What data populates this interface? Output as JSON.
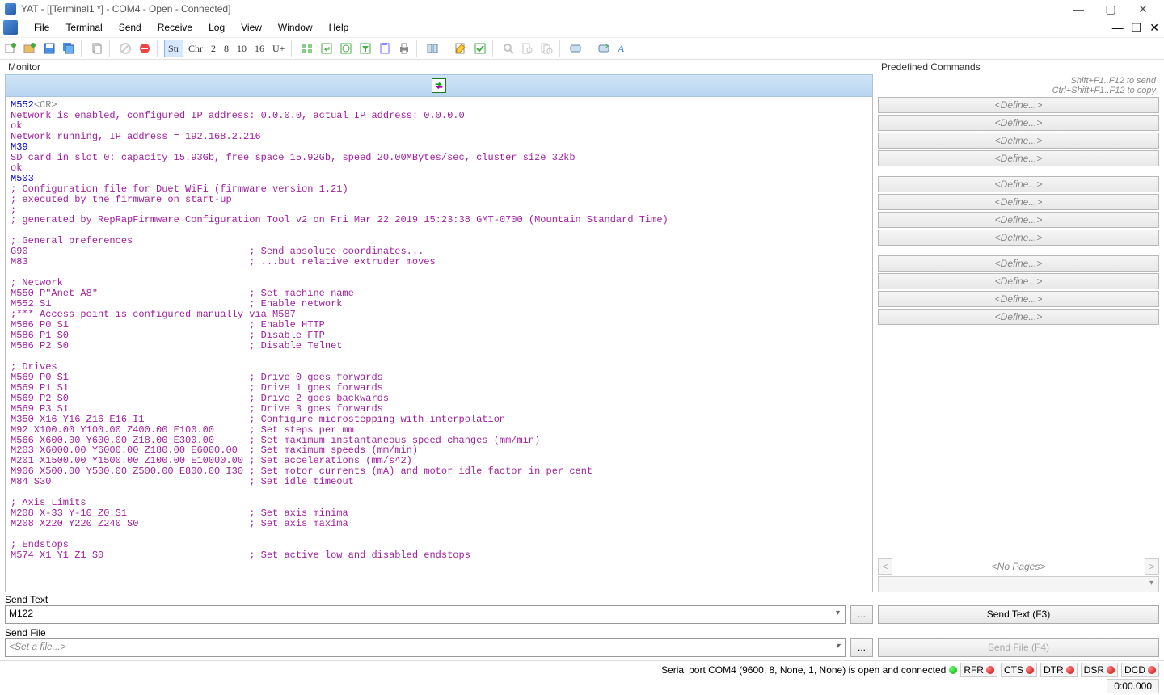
{
  "title": "YAT - [[Terminal1 *] - COM4 - Open - Connected]",
  "menu": {
    "file": "File",
    "terminal": "Terminal",
    "send": "Send",
    "receive": "Receive",
    "log": "Log",
    "view": "View",
    "window": "Window",
    "help": "Help"
  },
  "toolbar": {
    "str": "Str",
    "chr": "Chr",
    "n2": "2",
    "n8": "8",
    "n10": "10",
    "n16": "16",
    "uplus": "U+",
    "afont": "A"
  },
  "monitor": {
    "label": "Monitor",
    "lines": [
      {
        "cls": "cmd",
        "text": "M552",
        "suffix": "<CR>"
      },
      {
        "cls": "",
        "text": "Network is enabled, configured IP address: 0.0.0.0, actual IP address: 0.0.0.0"
      },
      {
        "cls": "",
        "text": "ok"
      },
      {
        "cls": "",
        "text": "Network running, IP address = 192.168.2.216"
      },
      {
        "cls": "cmd",
        "text": "M39"
      },
      {
        "cls": "",
        "text": "SD card in slot 0: capacity 15.93Gb, free space 15.92Gb, speed 20.00MBytes/sec, cluster size 32kb"
      },
      {
        "cls": "",
        "text": "ok"
      },
      {
        "cls": "cmd",
        "text": "M503"
      },
      {
        "cls": "",
        "text": "; Configuration file for Duet WiFi (firmware version 1.21)"
      },
      {
        "cls": "",
        "text": "; executed by the firmware on start-up"
      },
      {
        "cls": "",
        "text": ";"
      },
      {
        "cls": "",
        "text": "; generated by RepRapFirmware Configuration Tool v2 on Fri Mar 22 2019 15:23:38 GMT-0700 (Mountain Standard Time)"
      },
      {
        "cls": "",
        "text": ""
      },
      {
        "cls": "",
        "text": "; General preferences"
      },
      {
        "cls": "",
        "text": "G90                                      ; Send absolute coordinates..."
      },
      {
        "cls": "",
        "text": "M83                                      ; ...but relative extruder moves"
      },
      {
        "cls": "",
        "text": ""
      },
      {
        "cls": "",
        "text": "; Network"
      },
      {
        "cls": "",
        "text": "M550 P\"Anet A8\"                          ; Set machine name"
      },
      {
        "cls": "",
        "text": "M552 S1                                  ; Enable network"
      },
      {
        "cls": "",
        "text": ";*** Access point is configured manually via M587"
      },
      {
        "cls": "",
        "text": "M586 P0 S1                               ; Enable HTTP"
      },
      {
        "cls": "",
        "text": "M586 P1 S0                               ; Disable FTP"
      },
      {
        "cls": "",
        "text": "M586 P2 S0                               ; Disable Telnet"
      },
      {
        "cls": "",
        "text": ""
      },
      {
        "cls": "",
        "text": "; Drives"
      },
      {
        "cls": "",
        "text": "M569 P0 S1                               ; Drive 0 goes forwards"
      },
      {
        "cls": "",
        "text": "M569 P1 S1                               ; Drive 1 goes forwards"
      },
      {
        "cls": "",
        "text": "M569 P2 S0                               ; Drive 2 goes backwards"
      },
      {
        "cls": "",
        "text": "M569 P3 S1                               ; Drive 3 goes forwards"
      },
      {
        "cls": "",
        "text": "M350 X16 Y16 Z16 E16 I1                  ; Configure microstepping with interpolation"
      },
      {
        "cls": "",
        "text": "M92 X100.00 Y100.00 Z400.00 E100.00      ; Set steps per mm"
      },
      {
        "cls": "",
        "text": "M566 X600.00 Y600.00 Z18.00 E300.00      ; Set maximum instantaneous speed changes (mm/min)"
      },
      {
        "cls": "",
        "text": "M203 X6000.00 Y6000.00 Z180.00 E6000.00  ; Set maximum speeds (mm/min)"
      },
      {
        "cls": "",
        "text": "M201 X1500.00 Y1500.00 Z100.00 E10000.00 ; Set accelerations (mm/s^2)"
      },
      {
        "cls": "",
        "text": "M906 X500.00 Y500.00 Z500.00 E800.00 I30 ; Set motor currents (mA) and motor idle factor in per cent"
      },
      {
        "cls": "",
        "text": "M84 S30                                  ; Set idle timeout"
      },
      {
        "cls": "",
        "text": ""
      },
      {
        "cls": "",
        "text": "; Axis Limits"
      },
      {
        "cls": "",
        "text": "M208 X-33 Y-10 Z0 S1                     ; Set axis minima"
      },
      {
        "cls": "",
        "text": "M208 X220 Y220 Z240 S0                   ; Set axis maxima"
      },
      {
        "cls": "",
        "text": ""
      },
      {
        "cls": "",
        "text": "; Endstops"
      },
      {
        "cls": "",
        "text": "M574 X1 Y1 Z1 S0                         ; Set active low and disabled endstops"
      }
    ]
  },
  "predef": {
    "label": "Predefined Commands",
    "hint1": "Shift+F1..F12 to send",
    "hint2": "Ctrl+Shift+F1..F12 to copy",
    "define": "<Define...>",
    "nopages": "<No Pages>"
  },
  "sendtext": {
    "label": "Send Text",
    "value": "M122",
    "button": "Send Text (F3)",
    "dots": "..."
  },
  "sendfile": {
    "label": "Send File",
    "value": "<Set a file...>",
    "button": "Send File (F4)",
    "dots": "..."
  },
  "status": {
    "text": "Serial port COM4 (9600, 8, None, 1, None) is open and connected",
    "rfr": "RFR",
    "cts": "CTS",
    "dtr": "DTR",
    "dsr": "DSR",
    "dcd": "DCD",
    "timer": "0:00.000"
  }
}
